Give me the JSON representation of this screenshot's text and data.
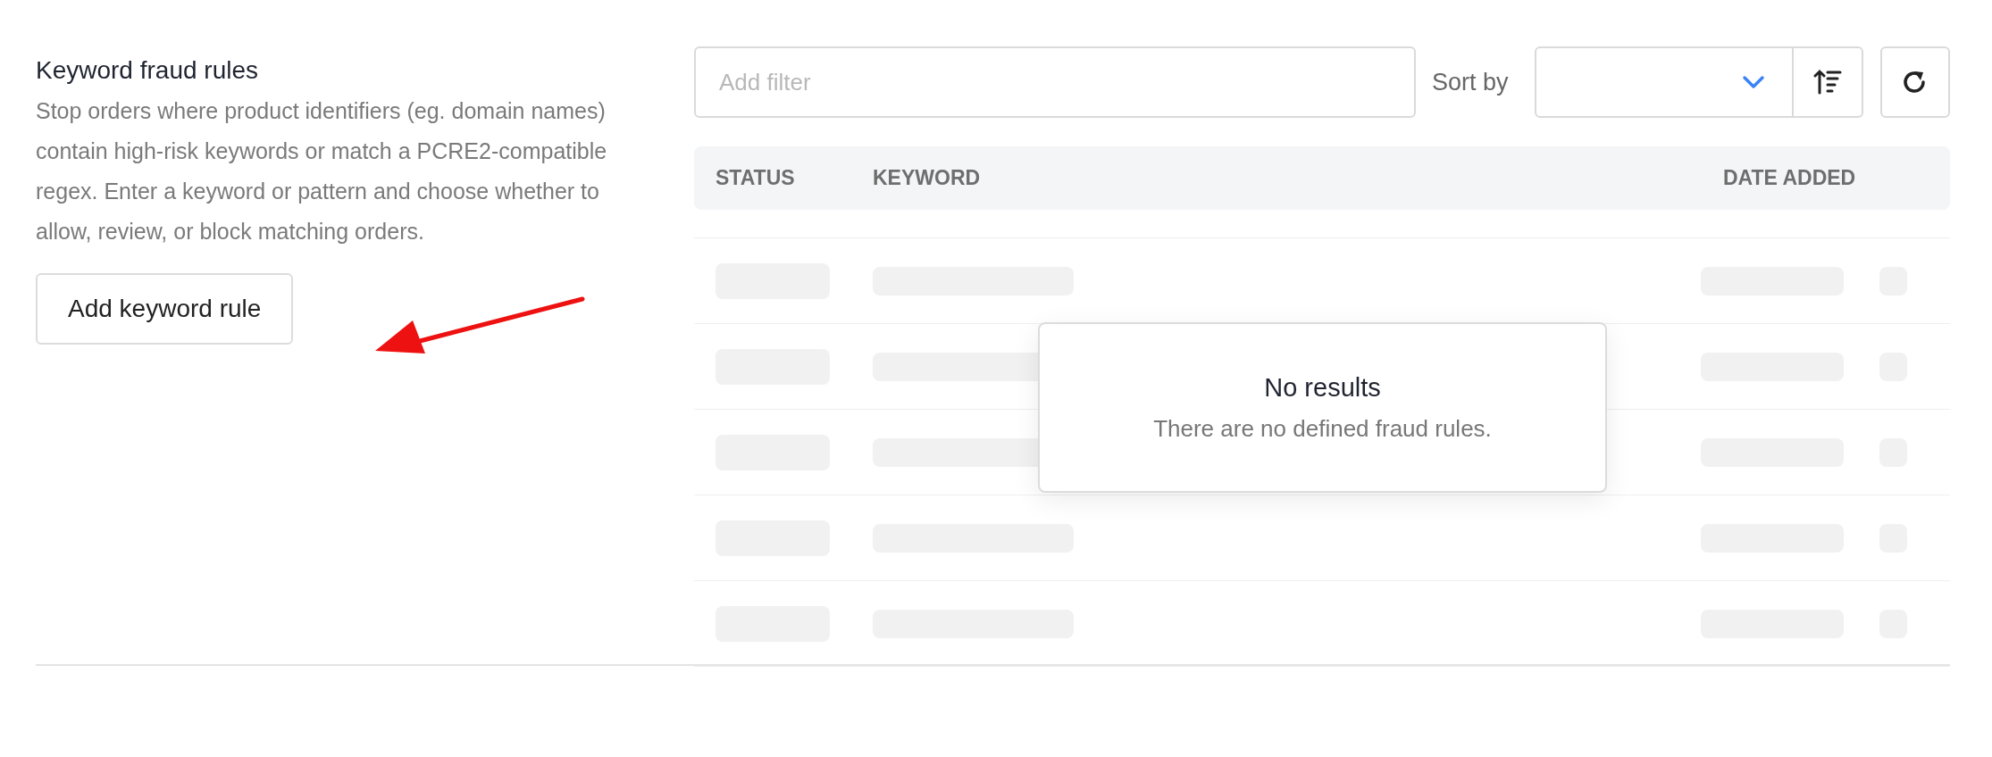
{
  "section": {
    "title": "Keyword fraud rules",
    "description": "Stop orders where product identifiers (eg. domain names) contain high-risk keywords or match a PCRE2-compatible regex. Enter a keyword or pattern and choose whether to allow, review, or block matching orders.",
    "add_button": "Add keyword rule"
  },
  "toolbar": {
    "filter": {
      "placeholder": "Add filter"
    },
    "sort_label": "Sort by"
  },
  "table": {
    "columns": [
      "STATUS",
      "KEYWORD",
      "DATE ADDED"
    ],
    "rows": [
      {
        "kind": "skeleton"
      },
      {
        "kind": "skeleton"
      },
      {
        "kind": "skeleton"
      },
      {
        "kind": "skeleton"
      },
      {
        "kind": "skeleton"
      }
    ]
  },
  "empty_state": {
    "title": "No results",
    "message": "There are no defined fraud rules."
  }
}
